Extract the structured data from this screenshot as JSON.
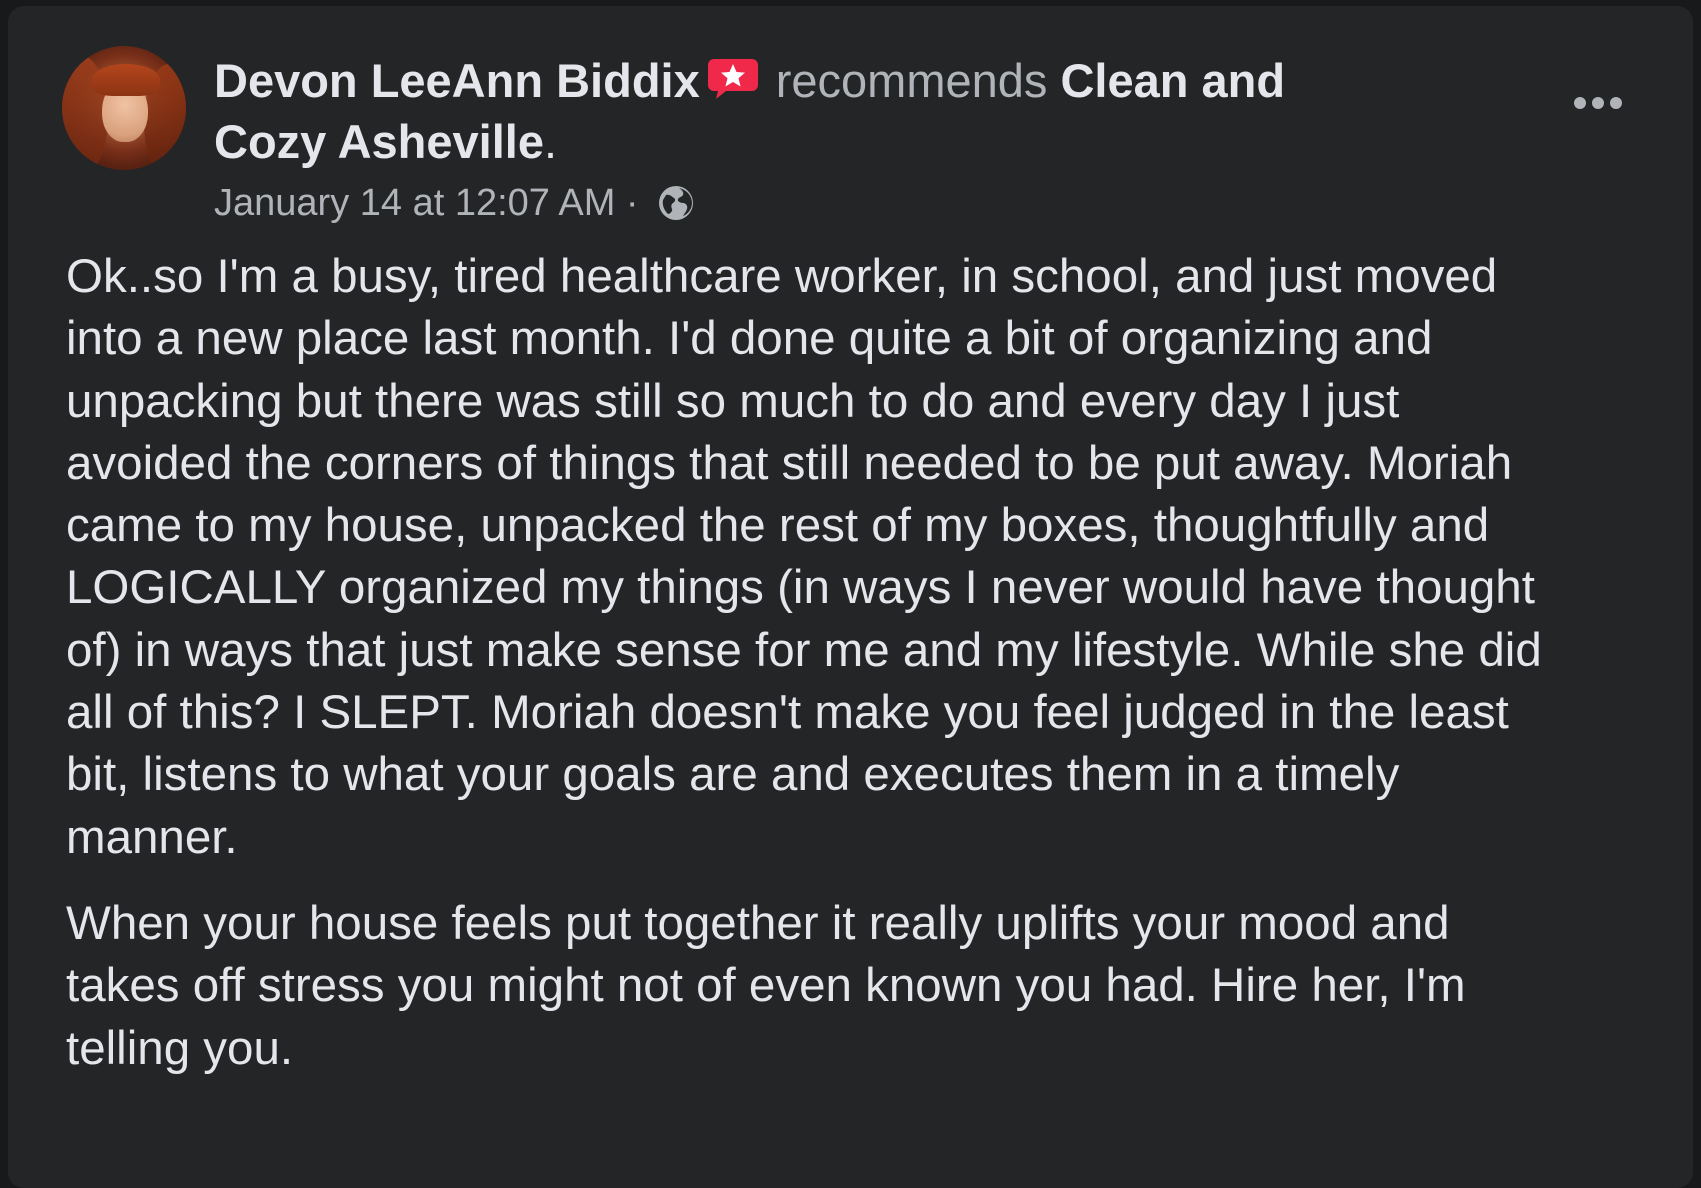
{
  "post": {
    "author": "Devon LeeAnn Biddix",
    "verb": "recommends",
    "page": "Clean and Cozy Asheville",
    "trailing_punct": ".",
    "timestamp": "January 14 at 12:07 AM",
    "separator": " · ",
    "privacy_icon": "globe-icon",
    "recommend_icon": "recommendation-star-icon",
    "more_icon": "more-options-icon",
    "paragraphs": [
      "Ok..so I'm a busy, tired healthcare worker, in school, and just moved\ninto a new place last month. I'd done quite a bit of organizing and\nunpacking but there was still so much to do and every day I just\navoided the corners of things that still needed to be put away. Moriah\ncame to my house, unpacked the rest of my boxes, thoughtfully and\nLOGICALLY organized my things (in ways I never would have thought\nof) in ways that just make sense for me and my lifestyle. While she did\nall of this? I SLEPT. Moriah doesn't make you feel judged in the least\nbit, listens to what your goals are and executes them in a timely\nmanner.",
      "When your house feels put together it really uplifts your mood and\ntakes off stress you might not of even known you had. Hire her, I'm\ntelling you."
    ]
  },
  "colors": {
    "card_bg": "#242526",
    "page_bg": "#18191a",
    "primary_text": "#e4e6eb",
    "secondary_text": "#b0b3b8",
    "recommend_badge": "#f02849"
  }
}
